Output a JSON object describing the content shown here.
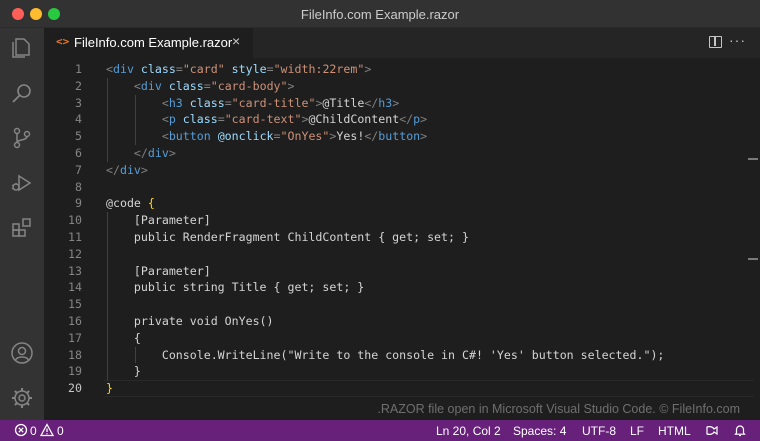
{
  "window": {
    "title": "FileInfo.com Example.razor"
  },
  "activity_bar": [
    {
      "name": "explorer-icon"
    },
    {
      "name": "search-icon"
    },
    {
      "name": "source-control-icon"
    },
    {
      "name": "run-debug-icon"
    },
    {
      "name": "extensions-icon"
    },
    {
      "name": "account-icon"
    },
    {
      "name": "settings-gear-icon"
    }
  ],
  "tab": {
    "icon": "<>",
    "label": "FileInfo.com Example.razor",
    "close": "×"
  },
  "tab_actions": {
    "more": "···"
  },
  "editor": {
    "active_line": 20,
    "lines": [
      {
        "n": "1"
      },
      {
        "n": "2"
      },
      {
        "n": "3"
      },
      {
        "n": "4"
      },
      {
        "n": "5"
      },
      {
        "n": "6"
      },
      {
        "n": "7"
      },
      {
        "n": "8"
      },
      {
        "n": "9"
      },
      {
        "n": "10"
      },
      {
        "n": "11"
      },
      {
        "n": "12"
      },
      {
        "n": "13"
      },
      {
        "n": "14"
      },
      {
        "n": "15"
      },
      {
        "n": "16"
      },
      {
        "n": "17"
      },
      {
        "n": "18"
      },
      {
        "n": "19"
      },
      {
        "n": "20"
      }
    ],
    "code": [
      [
        [
          "p",
          "<"
        ],
        [
          "t",
          "div"
        ],
        [
          "a",
          " class"
        ],
        [
          "p",
          "="
        ],
        [
          "s",
          "\"card\""
        ],
        [
          "a",
          " style"
        ],
        [
          "p",
          "="
        ],
        [
          "s",
          "\"width:22rem\""
        ],
        [
          "p",
          ">"
        ]
      ],
      [
        [
          "x",
          "    "
        ],
        [
          "p",
          "<"
        ],
        [
          "t",
          "div"
        ],
        [
          "a",
          " class"
        ],
        [
          "p",
          "="
        ],
        [
          "s",
          "\"card-body\""
        ],
        [
          "p",
          ">"
        ]
      ],
      [
        [
          "x",
          "        "
        ],
        [
          "p",
          "<"
        ],
        [
          "t",
          "h3"
        ],
        [
          "a",
          " class"
        ],
        [
          "p",
          "="
        ],
        [
          "s",
          "\"card-title\""
        ],
        [
          "p",
          ">"
        ],
        [
          "x",
          "@Title"
        ],
        [
          "p",
          "</"
        ],
        [
          "t",
          "h3"
        ],
        [
          "p",
          ">"
        ]
      ],
      [
        [
          "x",
          "        "
        ],
        [
          "p",
          "<"
        ],
        [
          "t",
          "p"
        ],
        [
          "a",
          " class"
        ],
        [
          "p",
          "="
        ],
        [
          "s",
          "\"card-text\""
        ],
        [
          "p",
          ">"
        ],
        [
          "x",
          "@ChildContent"
        ],
        [
          "p",
          "</"
        ],
        [
          "t",
          "p"
        ],
        [
          "p",
          ">"
        ]
      ],
      [
        [
          "x",
          "        "
        ],
        [
          "p",
          "<"
        ],
        [
          "t",
          "button"
        ],
        [
          "a",
          " @onclick"
        ],
        [
          "p",
          "="
        ],
        [
          "s",
          "\"OnYes\""
        ],
        [
          "p",
          ">"
        ],
        [
          "x",
          "Yes!"
        ],
        [
          "p",
          "</"
        ],
        [
          "t",
          "button"
        ],
        [
          "p",
          ">"
        ]
      ],
      [
        [
          "x",
          "    "
        ],
        [
          "p",
          "</"
        ],
        [
          "t",
          "div"
        ],
        [
          "p",
          ">"
        ]
      ],
      [
        [
          "p",
          "</"
        ],
        [
          "t",
          "div"
        ],
        [
          "p",
          ">"
        ]
      ],
      [],
      [
        [
          "x",
          "@code "
        ],
        [
          "b",
          "{"
        ]
      ],
      [
        [
          "x",
          "    [Parameter]"
        ]
      ],
      [
        [
          "x",
          "    public RenderFragment ChildContent { get; set; }"
        ]
      ],
      [],
      [
        [
          "x",
          "    [Parameter]"
        ]
      ],
      [
        [
          "x",
          "    public string Title { get; set; }"
        ]
      ],
      [],
      [
        [
          "x",
          "    private void OnYes()"
        ]
      ],
      [
        [
          "x",
          "    {"
        ]
      ],
      [
        [
          "x",
          "        Console.WriteLine(\"Write to the console in C#! 'Yes' button selected.\");"
        ]
      ],
      [
        [
          "x",
          "    }"
        ]
      ],
      [
        [
          "b",
          "}"
        ]
      ]
    ]
  },
  "watermark": ".RAZOR file open in Microsoft Visual Studio Code. © FileInfo.com",
  "status_bar": {
    "errors": "0",
    "warnings": "0",
    "position": "Ln 20, Col 2",
    "spaces": "Spaces: 4",
    "encoding": "UTF-8",
    "eol": "LF",
    "language": "HTML"
  },
  "colors": {
    "status_bar": "#68217a",
    "tag": "#569cd6",
    "attribute": "#9cdcfe",
    "string": "#ce9178",
    "punctuation": "#808080",
    "brace": "#ffd700"
  }
}
